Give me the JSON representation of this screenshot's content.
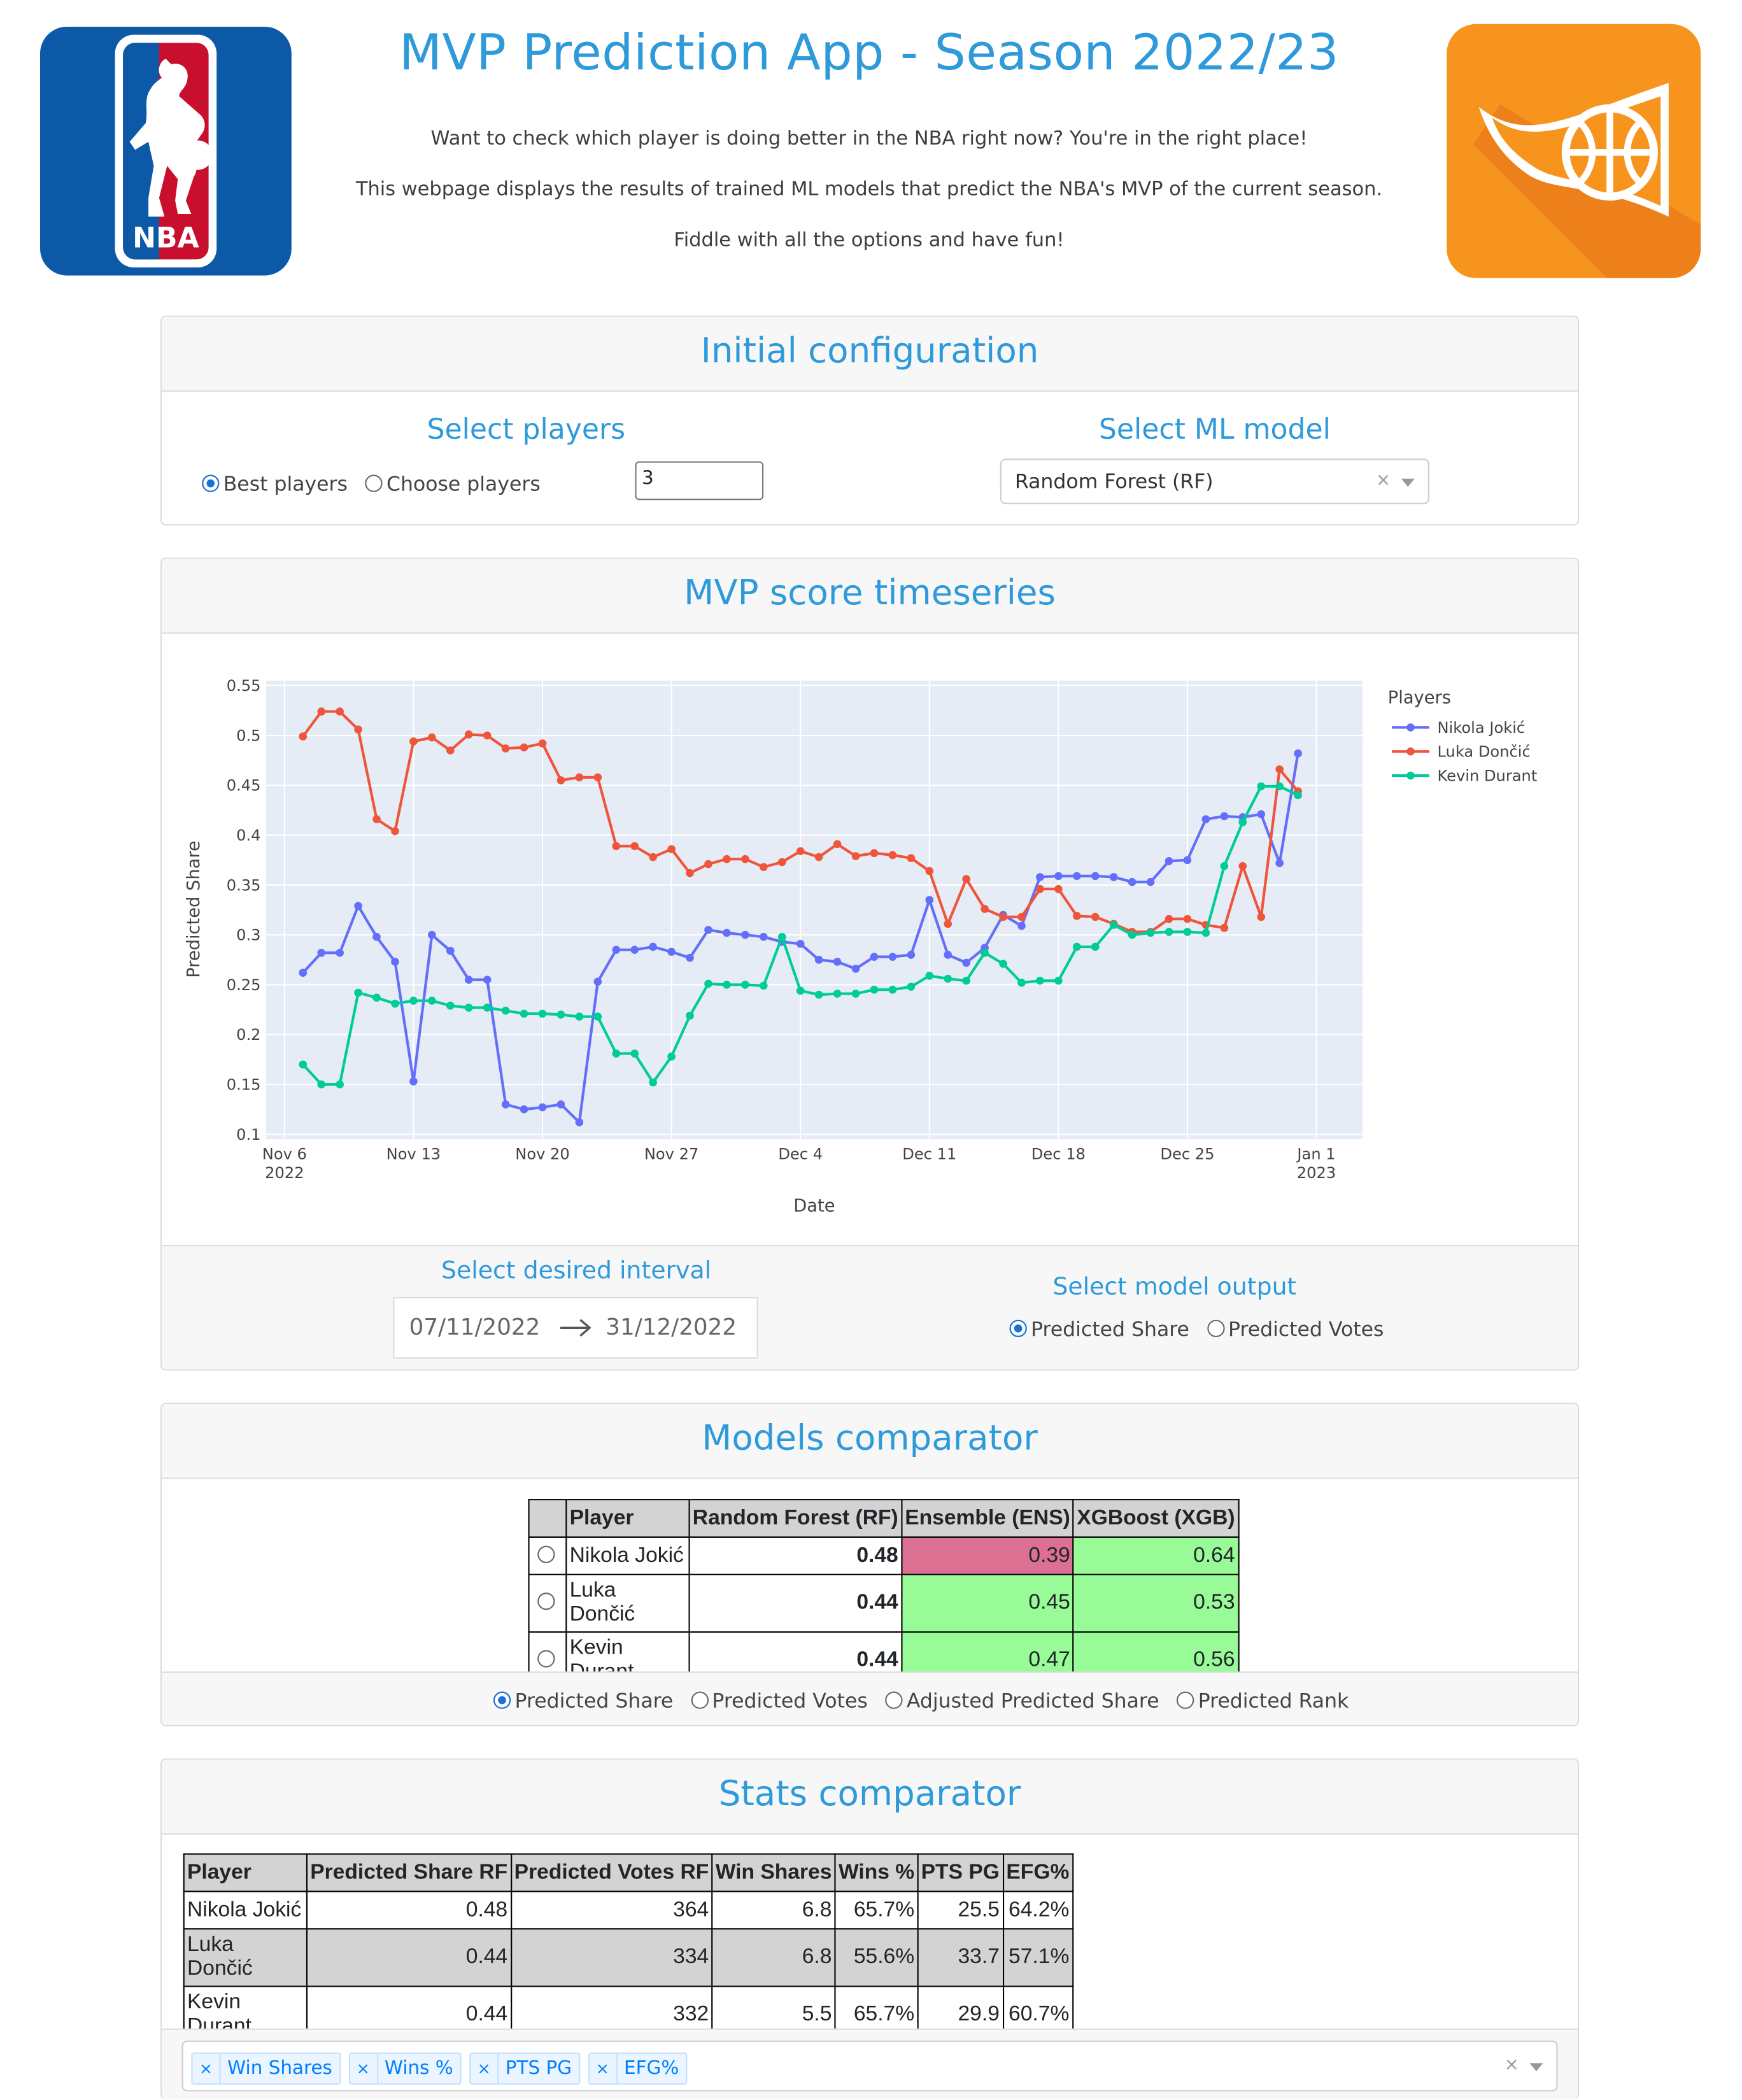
{
  "header": {
    "title": "MVP Prediction App - Season 2022/23",
    "intro_lines": [
      "Want to check which player is doing better in the NBA right now? You're in the right place!",
      "This webpage displays the results of trained ML models that predict the NBA's MVP of the current season.",
      "Fiddle with all the options and have fun!"
    ],
    "nba_logo_text": "NBA"
  },
  "config": {
    "title": "Initial configuration",
    "players_title": "Select players",
    "players_options": [
      "Best players",
      "Choose players"
    ],
    "players_selected": "Best players",
    "players_count": "3",
    "model_title": "Select ML model",
    "model_value": "Random Forest (RF)",
    "clear_symbol": "×"
  },
  "timeseries": {
    "title": "MVP score timeseries",
    "interval_title": "Select desired interval",
    "start_date": "07/11/2022",
    "end_date": "31/12/2022",
    "output_title": "Select model output",
    "output_options": [
      "Predicted Share",
      "Predicted Votes"
    ],
    "output_selected": "Predicted Share"
  },
  "chart_data": {
    "type": "line",
    "xlabel": "Date",
    "ylabel": "Predicted Share",
    "legend_title": "Players",
    "legend_position": "top-right",
    "ylim": [
      0.095,
      0.555
    ],
    "y_ticks": [
      "0.1",
      "0.15",
      "0.2",
      "0.25",
      "0.3",
      "0.35",
      "0.4",
      "0.45",
      "0.5",
      "0.55"
    ],
    "x_ticks": [
      {
        "day": 0,
        "label": "Nov 6",
        "sub": "2022"
      },
      {
        "day": 7,
        "label": "Nov 13",
        "sub": ""
      },
      {
        "day": 14,
        "label": "Nov 20",
        "sub": ""
      },
      {
        "day": 21,
        "label": "Nov 27",
        "sub": ""
      },
      {
        "day": 28,
        "label": "Dec 4",
        "sub": ""
      },
      {
        "day": 35,
        "label": "Dec 11",
        "sub": ""
      },
      {
        "day": 42,
        "label": "Dec 18",
        "sub": ""
      },
      {
        "day": 49,
        "label": "Dec 25",
        "sub": ""
      },
      {
        "day": 56,
        "label": "Jan 1",
        "sub": "2023"
      }
    ],
    "x_start": "2022-11-07",
    "x_end": "2022-12-31",
    "grid": true,
    "series": [
      {
        "name": "Nikola Jokić",
        "color": "#636efa",
        "values": [
          0.262,
          0.282,
          0.282,
          0.329,
          0.298,
          0.273,
          0.153,
          0.3,
          0.284,
          0.255,
          0.255,
          0.13,
          0.125,
          0.127,
          0.13,
          0.112,
          0.253,
          0.285,
          0.285,
          0.288,
          0.283,
          0.277,
          0.305,
          0.302,
          0.3,
          0.298,
          0.293,
          0.291,
          0.275,
          0.273,
          0.266,
          0.278,
          0.278,
          0.28,
          0.335,
          0.28,
          0.272,
          0.287,
          0.32,
          0.309,
          0.358,
          0.359,
          0.359,
          0.359,
          0.358,
          0.353,
          0.353,
          0.374,
          0.375,
          0.416,
          0.419,
          0.418,
          0.421,
          0.372,
          0.482
        ]
      },
      {
        "name": "Luka Dončić",
        "color": "#ef553b",
        "values": [
          0.499,
          0.524,
          0.524,
          0.506,
          0.416,
          0.404,
          0.494,
          0.498,
          0.485,
          0.501,
          0.5,
          0.487,
          0.488,
          0.492,
          0.455,
          0.458,
          0.458,
          0.389,
          0.389,
          0.378,
          0.386,
          0.362,
          0.371,
          0.376,
          0.376,
          0.368,
          0.373,
          0.384,
          0.378,
          0.391,
          0.379,
          0.382,
          0.38,
          0.377,
          0.364,
          0.311,
          0.356,
          0.326,
          0.318,
          0.318,
          0.346,
          0.346,
          0.319,
          0.318,
          0.311,
          0.303,
          0.303,
          0.316,
          0.316,
          0.31,
          0.307,
          0.369,
          0.318,
          0.466,
          0.444
        ]
      },
      {
        "name": "Kevin Durant",
        "color": "#00cc96",
        "values": [
          0.17,
          0.15,
          0.15,
          0.242,
          0.237,
          0.231,
          0.234,
          0.234,
          0.229,
          0.227,
          0.227,
          0.224,
          0.221,
          0.221,
          0.22,
          0.218,
          0.218,
          0.181,
          0.181,
          0.152,
          0.178,
          0.219,
          0.251,
          0.25,
          0.25,
          0.249,
          0.298,
          0.244,
          0.24,
          0.241,
          0.241,
          0.245,
          0.245,
          0.248,
          0.259,
          0.256,
          0.254,
          0.282,
          0.271,
          0.252,
          0.254,
          0.254,
          0.288,
          0.288,
          0.31,
          0.3,
          0.302,
          0.303,
          0.303,
          0.302,
          0.369,
          0.413,
          0.449,
          0.449,
          0.44
        ]
      }
    ]
  },
  "models": {
    "title": "Models comparator",
    "columns": [
      "Player",
      "Random Forest (RF)",
      "Ensemble (ENS)",
      "XGBoost (XGB)"
    ],
    "rows": [
      {
        "player": "Nikola Jokić",
        "rf": "0.48",
        "ens": "0.39",
        "xgb": "0.64"
      },
      {
        "player": "Luka Dončić",
        "rf": "0.44",
        "ens": "0.45",
        "xgb": "0.53"
      },
      {
        "player": "Kevin Durant",
        "rf": "0.44",
        "ens": "0.47",
        "xgb": "0.56"
      }
    ],
    "output_options": [
      "Predicted Share",
      "Predicted Votes",
      "Adjusted Predicted Share",
      "Predicted Rank"
    ],
    "output_selected": "Predicted Share"
  },
  "stats": {
    "title": "Stats comparator",
    "columns": [
      "Player",
      "Predicted Share RF",
      "Predicted Votes RF",
      "Win Shares",
      "Wins %",
      "PTS PG",
      "EFG%"
    ],
    "rows": [
      [
        "Nikola Jokić",
        "0.48",
        "364",
        "6.8",
        "65.7%",
        "25.5",
        "64.2%"
      ],
      [
        "Luka Dončić",
        "0.44",
        "334",
        "6.8",
        "55.6%",
        "33.7",
        "57.1%"
      ],
      [
        "Kevin Durant",
        "0.44",
        "332",
        "5.5",
        "65.7%",
        "29.9",
        "60.7%"
      ]
    ],
    "selected_stats": [
      "Win Shares",
      "Wins %",
      "PTS PG",
      "EFG%"
    ]
  }
}
